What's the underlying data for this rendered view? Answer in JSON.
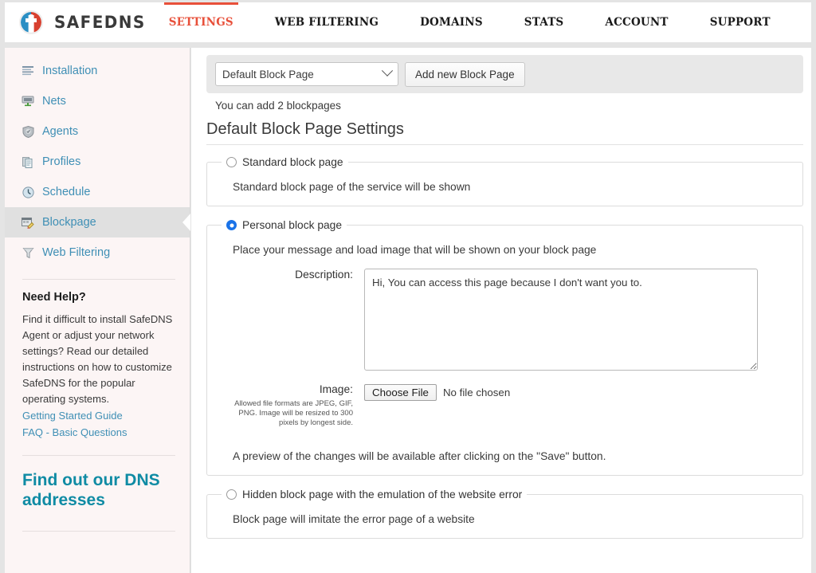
{
  "header": {
    "brand": "SAFEDNS",
    "logo_icon": "safedns-shield-logo",
    "accent_color": "#e8503a",
    "nav": [
      {
        "label": "SETTINGS",
        "active": true
      },
      {
        "label": "WEB FILTERING",
        "active": false
      },
      {
        "label": "DOMAINS",
        "active": false
      },
      {
        "label": "STATS",
        "active": false
      },
      {
        "label": "ACCOUNT",
        "active": false
      },
      {
        "label": "SUPPORT",
        "active": false
      }
    ]
  },
  "sidebar": {
    "items": [
      {
        "label": "Installation",
        "icon": "lines-icon",
        "active": false
      },
      {
        "label": "Nets",
        "icon": "network-icon",
        "active": false
      },
      {
        "label": "Agents",
        "icon": "shield-icon",
        "active": false
      },
      {
        "label": "Profiles",
        "icon": "documents-icon",
        "active": false
      },
      {
        "label": "Schedule",
        "icon": "clock-icon",
        "active": false
      },
      {
        "label": "Blockpage",
        "icon": "blockpage-icon",
        "active": true
      },
      {
        "label": "Web Filtering",
        "icon": "funnel-icon",
        "active": false
      }
    ],
    "help": {
      "title": "Need Help?",
      "body": "Find it difficult to install SafeDNS Agent or adjust your network settings? Read our detailed instructions on how to customize SafeDNS for the popular operating systems.",
      "links": [
        "Getting Started Guide",
        "FAQ - Basic Questions"
      ]
    },
    "dns_promo": {
      "title": "Find out our DNS addresses"
    },
    "link_color": "#3f8fb5",
    "promo_color": "#0f8ba4"
  },
  "main": {
    "toolbar": {
      "select_value": "Default Block Page",
      "select_icon": "chevron-down-icon",
      "add_button": "Add new Block Page"
    },
    "quota_hint": "You can add 2 blockpages",
    "page_title": "Default Block Page Settings",
    "sections": [
      {
        "legend": "Standard block page",
        "selected": false,
        "description": "Standard block page of the service will be shown"
      },
      {
        "legend": "Personal block page",
        "selected": true,
        "description": "Place your message and load image that will be shown on your block page",
        "fields": {
          "description_label": "Description:",
          "description_value": "Hi, You can access this page because I don't want you to.",
          "image_label": "Image:",
          "image_note": "Allowed file formats are JPEG, GIF, PNG. Image will be resized to 300 pixels by longest side.",
          "choose_file_button": "Choose File",
          "file_status": "No file chosen"
        },
        "preview_note": "A preview of the changes will be available after clicking on the \"Save\" button."
      },
      {
        "legend": "Hidden block page with the emulation of the website error",
        "selected": false,
        "description": "Block page will imitate the error page of a website"
      }
    ]
  }
}
